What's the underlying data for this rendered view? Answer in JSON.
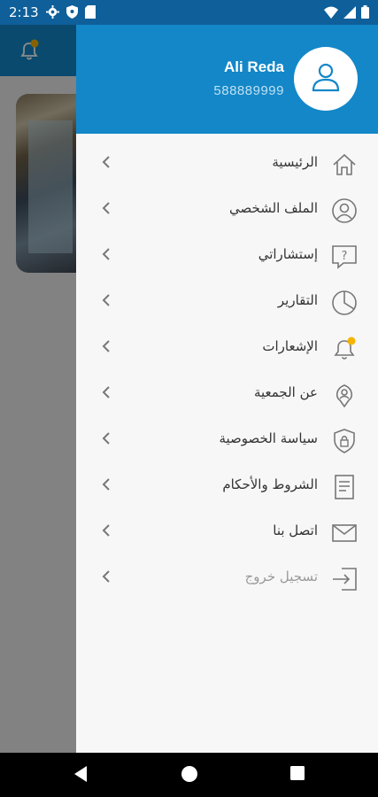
{
  "status_bar": {
    "time": "2:13",
    "icons": [
      "gear-icon",
      "shield-icon",
      "sim-icon",
      "wifi-icon",
      "signal-icon",
      "battery-icon"
    ]
  },
  "background": {
    "notification_dot_color": "#f5b400"
  },
  "drawer": {
    "user": {
      "name": "Ali Reda",
      "phone": "588889999"
    },
    "header_color": "#1387c8",
    "items": [
      {
        "label": "الرئيسية",
        "icon": "home-icon"
      },
      {
        "label": "الملف الشخصي",
        "icon": "profile-icon"
      },
      {
        "label": "إستشاراتي",
        "icon": "question-bubble-icon"
      },
      {
        "label": "التقارير",
        "icon": "pie-chart-icon"
      },
      {
        "label": "الإشعارات",
        "icon": "bell-icon"
      },
      {
        "label": "عن الجمعية",
        "icon": "location-pin-icon"
      },
      {
        "label": "سياسة الخصوصية",
        "icon": "shield-lock-icon"
      },
      {
        "label": "الشروط والأحكام",
        "icon": "document-icon"
      },
      {
        "label": "اتصل بنا",
        "icon": "mail-icon"
      },
      {
        "label": "تسجيل خروج",
        "icon": "logout-icon"
      }
    ]
  },
  "nav_bar": {
    "buttons": [
      "back-icon",
      "home-circle-icon",
      "recents-icon"
    ]
  }
}
